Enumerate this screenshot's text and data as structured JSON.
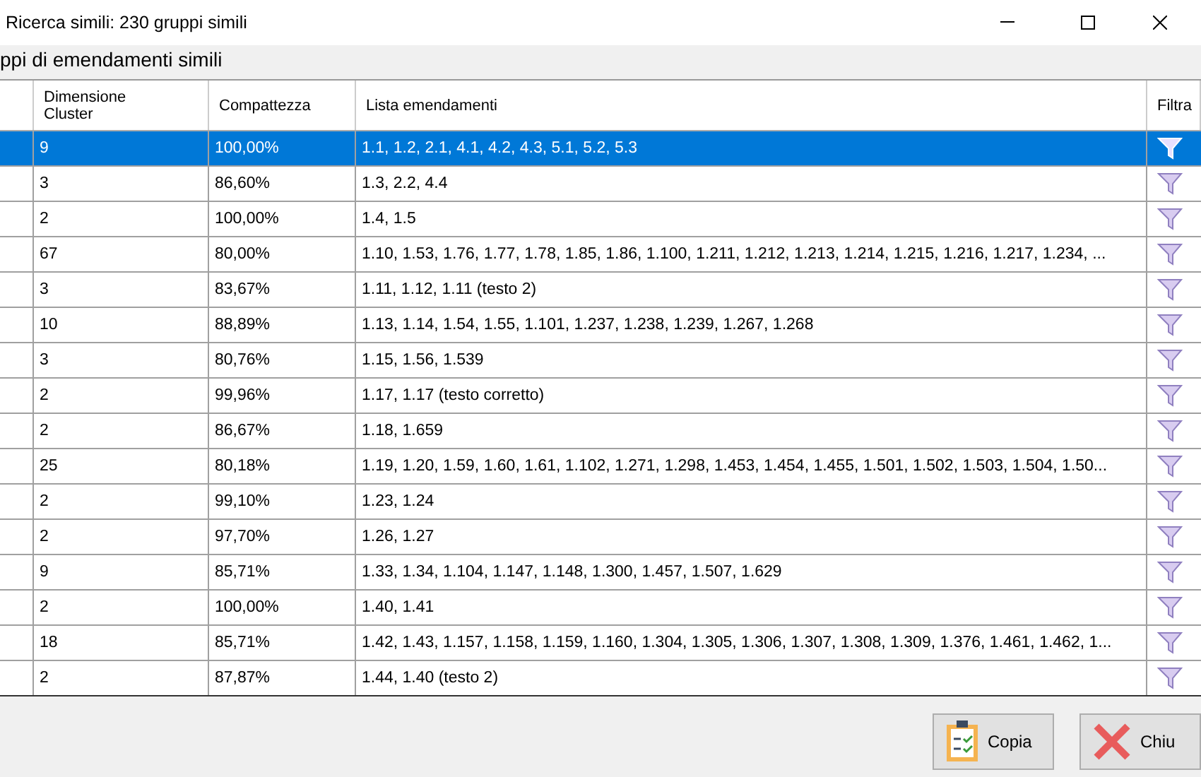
{
  "window": {
    "title": "Ricerca simili: 230 gruppi simili"
  },
  "group_title": "ppi di emendamenti simili",
  "table": {
    "columns": [
      "Dimensione Cluster",
      "Compattezza",
      "Lista emendamenti",
      "Filtra"
    ],
    "rows": [
      {
        "size": "9",
        "compactness": "100,00%",
        "list": "1.1, 1.2, 2.1, 4.1, 4.2, 4.3, 5.1, 5.2, 5.3",
        "selected": true
      },
      {
        "size": "3",
        "compactness": "86,60%",
        "list": "1.3, 2.2, 4.4",
        "selected": false
      },
      {
        "size": "2",
        "compactness": "100,00%",
        "list": "1.4, 1.5",
        "selected": false
      },
      {
        "size": "67",
        "compactness": "80,00%",
        "list": "1.10, 1.53, 1.76, 1.77, 1.78, 1.85, 1.86, 1.100, 1.211, 1.212, 1.213, 1.214, 1.215, 1.216, 1.217, 1.234, ...",
        "selected": false
      },
      {
        "size": "3",
        "compactness": "83,67%",
        "list": "1.11, 1.12, 1.11 (testo 2)",
        "selected": false
      },
      {
        "size": "10",
        "compactness": "88,89%",
        "list": "1.13, 1.14, 1.54, 1.55, 1.101, 1.237, 1.238, 1.239, 1.267, 1.268",
        "selected": false
      },
      {
        "size": "3",
        "compactness": "80,76%",
        "list": "1.15, 1.56, 1.539",
        "selected": false
      },
      {
        "size": "2",
        "compactness": "99,96%",
        "list": "1.17, 1.17 (testo corretto)",
        "selected": false
      },
      {
        "size": "2",
        "compactness": "86,67%",
        "list": "1.18, 1.659",
        "selected": false
      },
      {
        "size": "25",
        "compactness": "80,18%",
        "list": "1.19, 1.20, 1.59, 1.60, 1.61, 1.102, 1.271, 1.298, 1.453, 1.454, 1.455, 1.501, 1.502, 1.503, 1.504, 1.50...",
        "selected": false
      },
      {
        "size": "2",
        "compactness": "99,10%",
        "list": "1.23, 1.24",
        "selected": false
      },
      {
        "size": "2",
        "compactness": "97,70%",
        "list": "1.26, 1.27",
        "selected": false
      },
      {
        "size": "9",
        "compactness": "85,71%",
        "list": "1.33, 1.34, 1.104, 1.147, 1.148, 1.300, 1.457, 1.507, 1.629",
        "selected": false
      },
      {
        "size": "2",
        "compactness": "100,00%",
        "list": "1.40, 1.41",
        "selected": false
      },
      {
        "size": "18",
        "compactness": "85,71%",
        "list": "1.42, 1.43, 1.157, 1.158, 1.159, 1.160, 1.304, 1.305, 1.306, 1.307, 1.308, 1.309, 1.376, 1.461, 1.462, 1...",
        "selected": false
      },
      {
        "size": "2",
        "compactness": "87,87%",
        "list": "1.44, 1.40 (testo 2)",
        "selected": false
      }
    ]
  },
  "buttons": [
    {
      "label": "Copia",
      "kind": "copy"
    },
    {
      "label": "Chiu",
      "kind": "close"
    }
  ]
}
